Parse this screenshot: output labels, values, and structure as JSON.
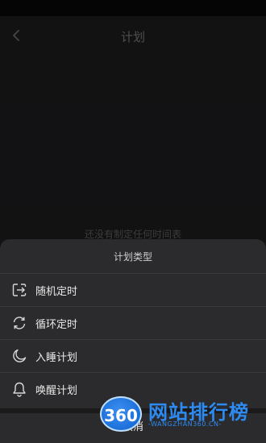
{
  "nav": {
    "title": "计划",
    "back_icon": "chevron-left-icon"
  },
  "empty_state": {
    "text": "还没有制定任何时间表"
  },
  "sheet": {
    "title": "计划类型",
    "items": [
      {
        "label": "随机定时",
        "icon": "random-exit-icon"
      },
      {
        "label": "循环定时",
        "icon": "refresh-cycle-icon"
      },
      {
        "label": "入睡计划",
        "icon": "moon-icon"
      },
      {
        "label": "唤醒计划",
        "icon": "bell-icon"
      }
    ],
    "cancel_label": "取消"
  },
  "watermark": {
    "number": "360",
    "name": "网站排行榜",
    "url": "-WANGZHAN360.CN-"
  },
  "colors": {
    "background": "#1c1c1e",
    "sheet": "#2b2b2d",
    "watermark_blue": "#2d8af0"
  }
}
